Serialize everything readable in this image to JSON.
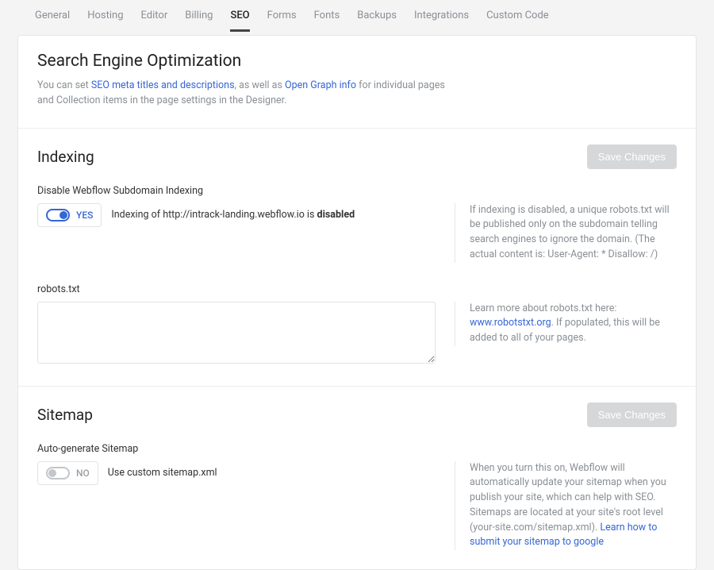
{
  "tabs": [
    "General",
    "Hosting",
    "Editor",
    "Billing",
    "SEO",
    "Forms",
    "Fonts",
    "Backups",
    "Integrations",
    "Custom Code"
  ],
  "active_tab": "SEO",
  "seo_header": {
    "title": "Search Engine Optimization",
    "desc_prefix": "You can set ",
    "link1": "SEO meta titles and descriptions",
    "desc_mid": ", as well as ",
    "link2": "Open Graph info",
    "desc_suffix": " for individual pages and Collection items in the page settings in the Designer."
  },
  "indexing": {
    "title": "Indexing",
    "save_label": "Save Changes",
    "disable_label": "Disable Webflow Subdomain Indexing",
    "toggle_state": "YES",
    "status_prefix": "Indexing of http://intrack-landing.webflow.io is ",
    "status_strong": "disabled",
    "help_disabled": "If indexing is disabled, a unique robots.txt will be published only on the subdomain telling search engines to ignore the domain. (The actual content is: User-Agent: * Disallow: /)",
    "robots_label": "robots.txt",
    "robots_value": "",
    "robots_help_prefix": "Learn more about robots.txt here: ",
    "robots_help_link": "www.robotstxt.org",
    "robots_help_suffix": ". If populated, this will be added to all of your pages."
  },
  "sitemap": {
    "title": "Sitemap",
    "save_label": "Save Changes",
    "auto_label": "Auto-generate Sitemap",
    "toggle_state": "NO",
    "custom_text": "Use custom sitemap.xml",
    "help_text": "When you turn this on, Webflow will automatically update your sitemap when you publish your site, which can help with SEO. Sitemaps are located at your site's root level (your-site.com/sitemap.xml). ",
    "help_link": "Learn how to submit your sitemap to google"
  }
}
